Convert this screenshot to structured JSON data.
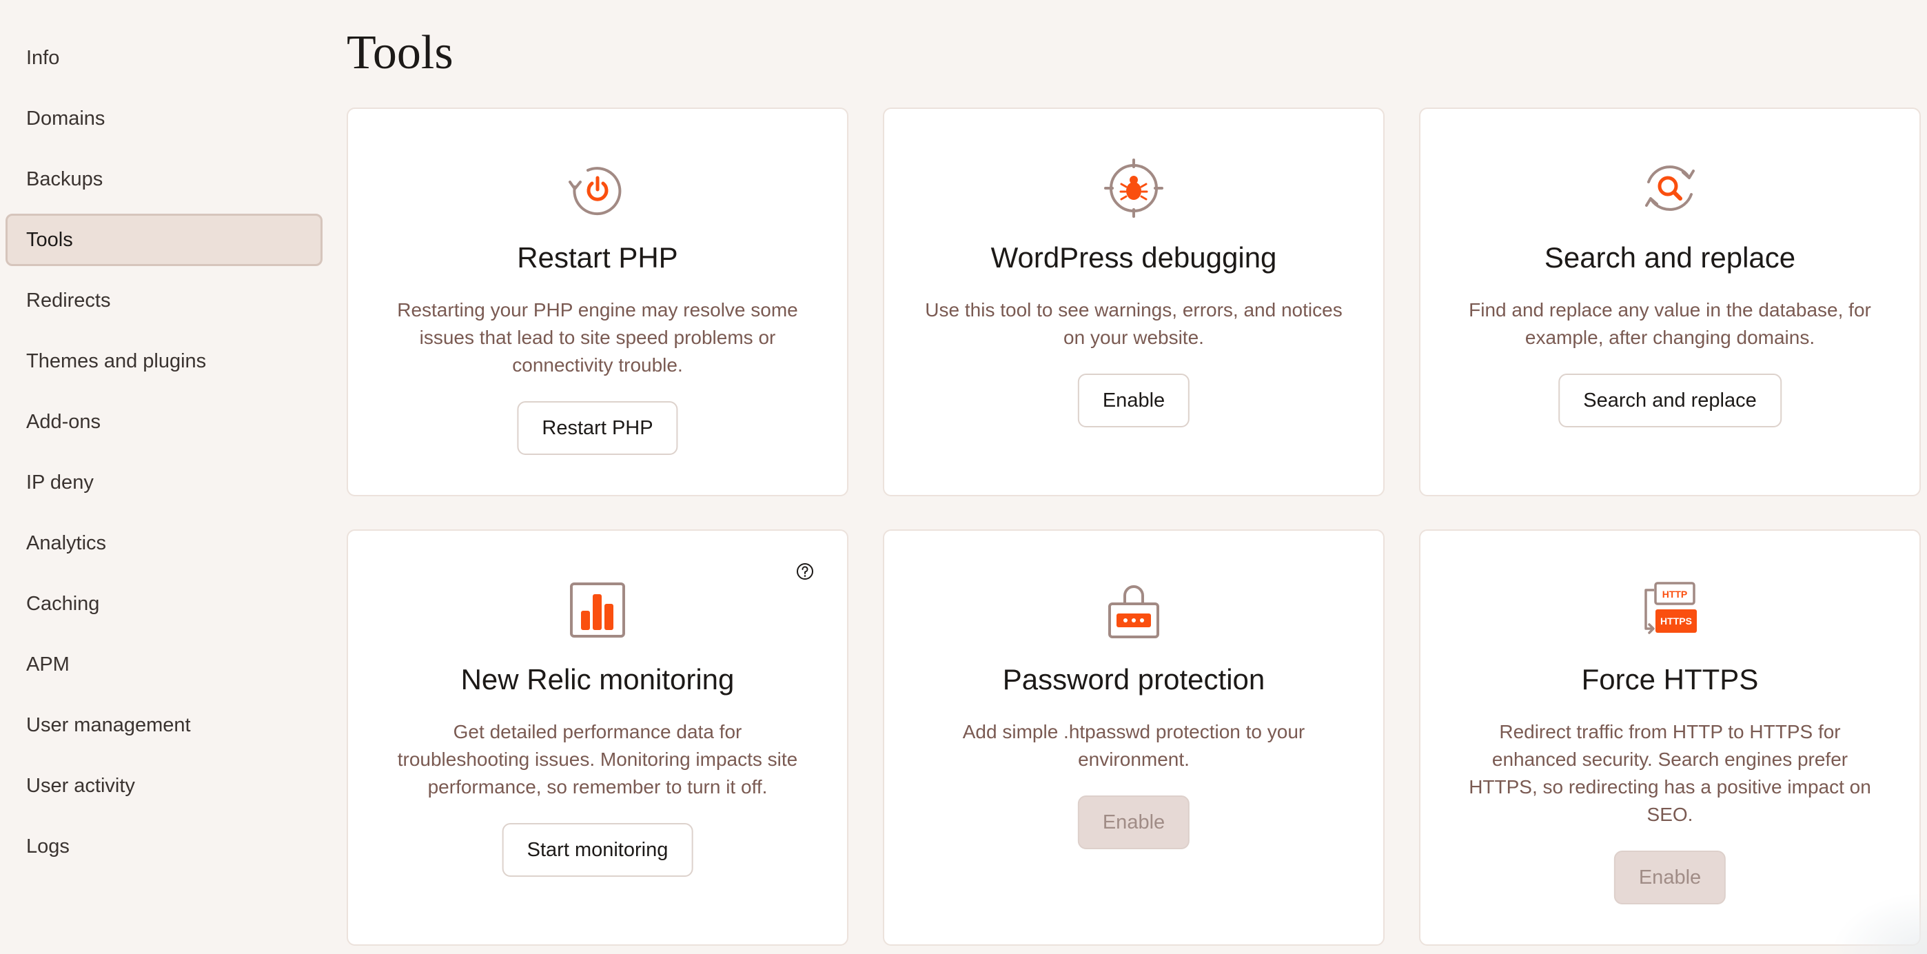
{
  "page": {
    "title": "Tools"
  },
  "sidebar": {
    "items": [
      {
        "label": "Info"
      },
      {
        "label": "Domains"
      },
      {
        "label": "Backups"
      },
      {
        "label": "Tools",
        "active": true
      },
      {
        "label": "Redirects"
      },
      {
        "label": "Themes and plugins"
      },
      {
        "label": "Add-ons"
      },
      {
        "label": "IP deny"
      },
      {
        "label": "Analytics"
      },
      {
        "label": "Caching"
      },
      {
        "label": "APM"
      },
      {
        "label": "User management"
      },
      {
        "label": "User activity"
      },
      {
        "label": "Logs"
      }
    ]
  },
  "cards": {
    "restart_php": {
      "title": "Restart PHP",
      "description": "Restarting your PHP engine may resolve some issues that lead to site speed problems or connectivity trouble.",
      "button": "Restart PHP",
      "icon": "power-restart-icon"
    },
    "wp_debugging": {
      "title": "WordPress debugging",
      "description": "Use this tool to see warnings, errors, and notices on your website.",
      "button": "Enable",
      "icon": "bug-target-icon"
    },
    "search_replace": {
      "title": "Search and replace",
      "description": "Find and replace any value in the database, for example, after changing domains.",
      "button": "Search and replace",
      "icon": "search-refresh-icon"
    },
    "new_relic": {
      "title": "New Relic monitoring",
      "description": "Get detailed performance data for troubleshooting issues. Monitoring impacts site performance, so remember to turn it off.",
      "button": "Start monitoring",
      "icon": "bar-chart-icon"
    },
    "password_protection": {
      "title": "Password protection",
      "description": "Add simple .htpasswd protection to your environment.",
      "button": "Enable",
      "icon": "lock-icon",
      "disabled": true
    },
    "force_https": {
      "title": "Force HTTPS",
      "description": "Redirect traffic from HTTP to HTTPS for enhanced security. Search engines prefer HTTPS, so redirecting has a positive impact on SEO.",
      "button": "Enable",
      "icon": "http-https-icon",
      "icon_text_top": "HTTP",
      "icon_text_bottom": "HTTPS",
      "disabled": true
    }
  },
  "colors": {
    "accent": "#fa4f0f",
    "icon_outline": "#a28a84",
    "background": "#f8f4f1",
    "active_nav": "#ece0d9"
  }
}
